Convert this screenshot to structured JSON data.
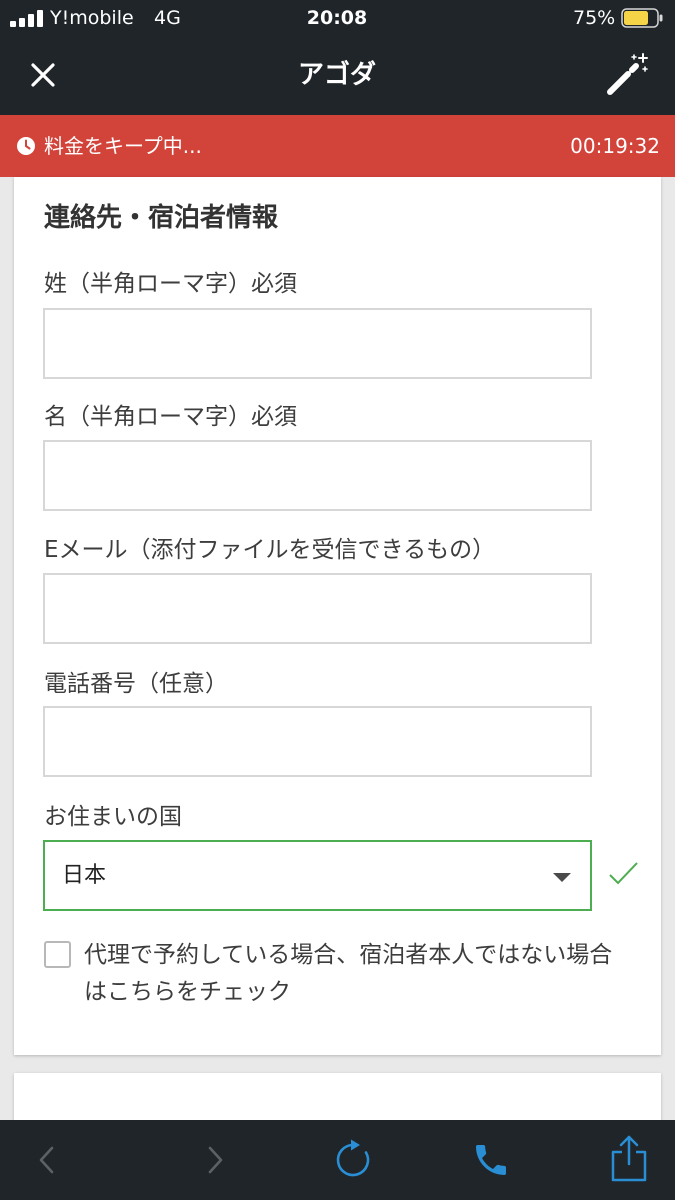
{
  "colors": {
    "bar_background": "#1f2529",
    "banner_red": "#d2433a",
    "valid_green": "#4cae50",
    "toolbar_blue": "#2a8ed4",
    "disabled_gray": "#5b6166",
    "page_background": "#e9e9e9",
    "battery_yellow": "#f5d547"
  },
  "status_bar": {
    "signal_icon": "signal-bars-icon",
    "carrier": "Y!mobile",
    "network": "4G",
    "time": "20:08",
    "battery_text": "75%",
    "battery_level": 0.75,
    "battery_icon": "battery-icon"
  },
  "nav_bar": {
    "close_icon": "close-icon",
    "title": "アゴダ",
    "action_icon": "magic-wand-icon"
  },
  "price_hold_banner": {
    "icon": "clock-icon",
    "message": "料金をキープ中...",
    "countdown": "00:19:32"
  },
  "contact_section": {
    "title": "連絡先・宿泊者情報",
    "fields": [
      {
        "label": "姓（半角ローマ字）必須",
        "value": "",
        "placeholder": ""
      },
      {
        "label": "名（半角ローマ字）必須",
        "value": "",
        "placeholder": ""
      },
      {
        "label": "Eメール（添付ファイルを受信できるもの）",
        "value": "",
        "placeholder": ""
      },
      {
        "label": "電話番号（任意）",
        "value": "",
        "placeholder": ""
      }
    ],
    "country": {
      "label": "お住まいの国",
      "selected": "日本",
      "dropdown_icon": "caret-down-icon",
      "valid": true,
      "valid_icon": "checkmark-icon"
    },
    "proxy_booking": {
      "checked": false,
      "label_lines": [
        "代理で予約している場合、宿泊者本人ではない場合",
        "はこちらをチェック"
      ]
    }
  },
  "toolbar": {
    "items": [
      {
        "icon": "chevron-left-icon",
        "enabled": false
      },
      {
        "icon": "chevron-right-icon",
        "enabled": false
      },
      {
        "icon": "refresh-icon",
        "enabled": true
      },
      {
        "icon": "phone-icon",
        "enabled": true
      },
      {
        "icon": "share-icon",
        "enabled": true
      }
    ]
  }
}
